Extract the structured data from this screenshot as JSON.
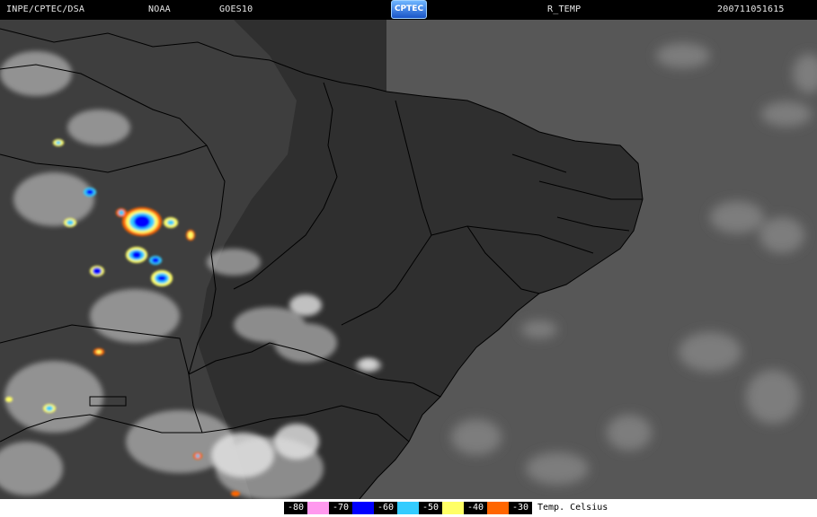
{
  "header": {
    "source": "INPE/CPTEC/DSA",
    "agency": "NOAA",
    "satellite": "GOES10",
    "logo_text": "CPTEC",
    "product": "R_TEMP",
    "timestamp": "200711051615"
  },
  "legend": {
    "items": [
      {
        "label": "-80",
        "color": "#ff99ee"
      },
      {
        "label": "-70",
        "color": "#0000ff"
      },
      {
        "label": "-60",
        "color": "#33ccff"
      },
      {
        "label": "-50",
        "color": "#ffff66"
      },
      {
        "label": "-40",
        "color": "#ff6600"
      },
      {
        "label": "-30",
        "color": "#000000"
      }
    ],
    "unit": "Temp. Celsius"
  },
  "colors": {
    "ocean": "#5a5a5a",
    "land_dark": "#2e2e2e",
    "cloud": "#cfcfcf",
    "border_line": "#000000"
  }
}
